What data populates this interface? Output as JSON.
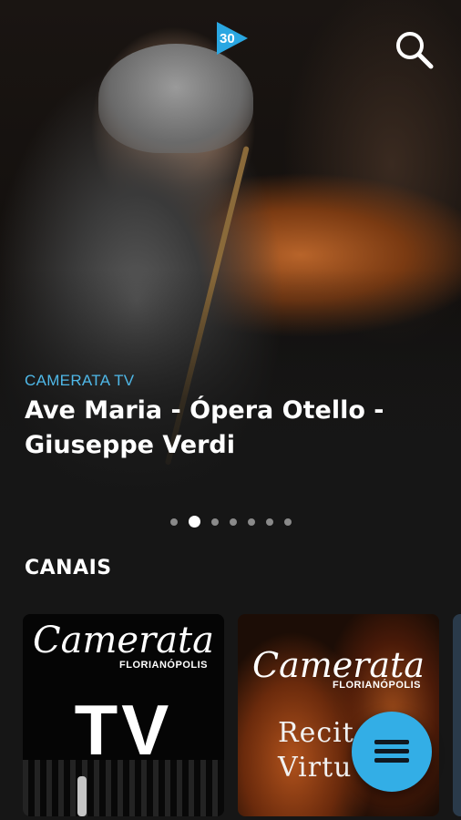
{
  "app": {
    "logo_text": "30",
    "accent": "#33aee6"
  },
  "header": {
    "search_icon": "search-icon"
  },
  "hero": {
    "category": "CAMERATA TV",
    "title": "Ave Maria - Ópera Otello - Giuseppe Verdi",
    "carousel": {
      "total": 7,
      "active_index": 1
    }
  },
  "section": {
    "title": "CANAIS"
  },
  "channels": [
    {
      "brand": "Camerata",
      "sub": "FLORIANÓPOLIS",
      "label": "TV"
    },
    {
      "brand": "Camerata",
      "sub": "FLORIANÓPOLIS",
      "label_line1": "Recit",
      "label_line2": "Virtu"
    }
  ],
  "fab": {
    "icon": "menu-icon"
  }
}
